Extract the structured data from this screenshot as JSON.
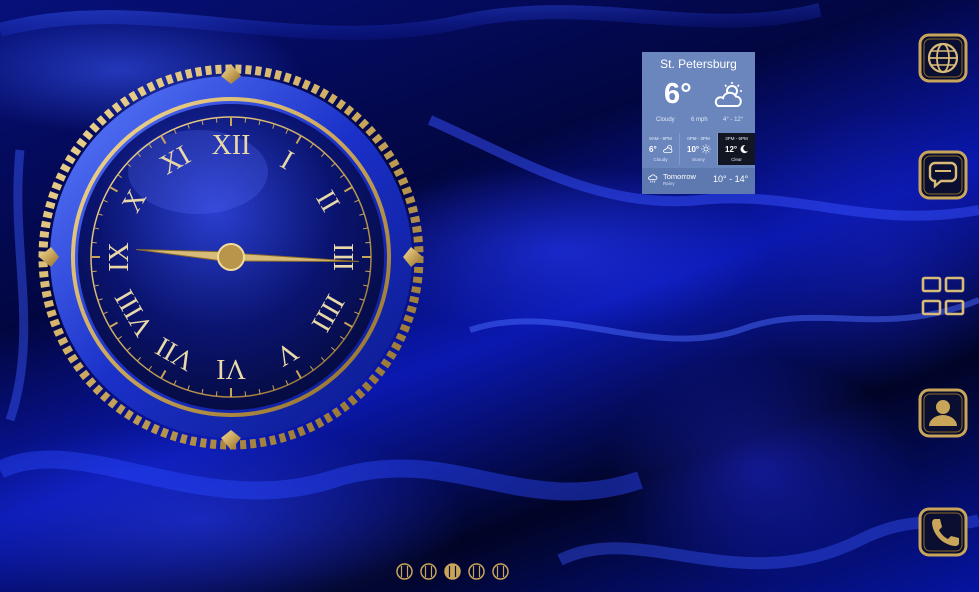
{
  "weather": {
    "city": "St. Petersburg",
    "current_temp": "6°",
    "current_icon": "partly-cloudy-icon",
    "condition": "Cloudy",
    "wind": "6 mph",
    "range": "4° - 12°",
    "periods": [
      {
        "title": "9AM - 9PM",
        "temp": "6°",
        "icon": "partly-cloudy-icon",
        "condition": "Cloudy"
      },
      {
        "title": "0PM - 3PM",
        "temp": "10°",
        "icon": "sun-icon",
        "condition": "Sunny"
      },
      {
        "title": "3PM - 6PM",
        "temp": "12°",
        "icon": "moon-icon",
        "condition": "Clear"
      }
    ],
    "tomorrow": {
      "label": "Tomorrow",
      "sub": "Rainy",
      "range": "10° - 14°",
      "icon": "rain-cloud-icon"
    }
  },
  "clock": {
    "numerals": [
      "XII",
      "I",
      "II",
      "III",
      "IIII",
      "V",
      "VI",
      "VII",
      "VIII",
      "IX",
      "X",
      "XI"
    ],
    "hour": 9,
    "minute": 9,
    "colors": {
      "gold": "#c9a55a",
      "face": "#0d1a7a",
      "ring": "#2340d8"
    }
  },
  "dock": [
    {
      "name": "browser-globe-icon"
    },
    {
      "name": "messaging-chat-icon"
    },
    {
      "name": "app-drawer-grid-icon"
    },
    {
      "name": "contacts-person-icon"
    },
    {
      "name": "phone-icon"
    }
  ],
  "pager": {
    "count": 5,
    "active_index": 2
  },
  "colors": {
    "accent_gold": "#c9a55a",
    "background_blue": "#0a18b0",
    "weather_bg": "#6b86bd"
  }
}
